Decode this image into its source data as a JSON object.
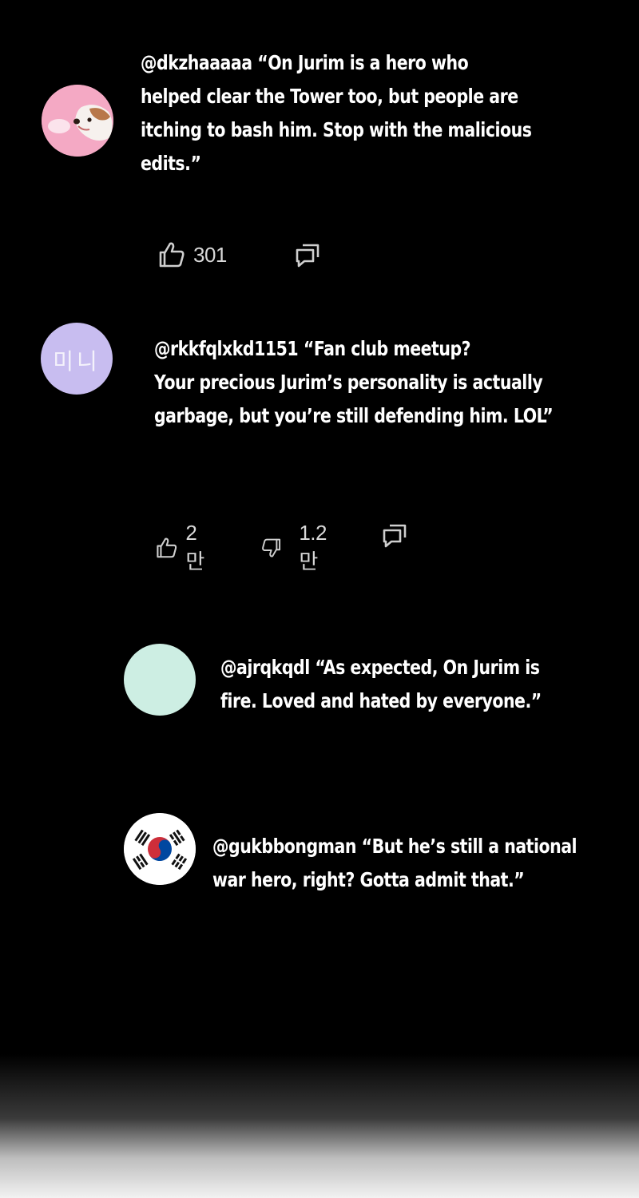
{
  "comments": [
    {
      "avatar": "pink-dog-avatar",
      "lines": [
        "@dkzhaaaaa “On Jurim is a hero who",
        "helped clear the Tower too, but people are",
        " itching to bash him. Stop with the malicious",
        "edits.”"
      ],
      "likes": "301"
    },
    {
      "avatar": "lavender-text-avatar",
      "avatar_text": "미니",
      "lines": [
        "@rkkfqlxkd1151 “Fan club meetup?",
        " Your precious Jurim’s personality is actually",
        " garbage, but you’re still defending him. LOL”"
      ],
      "likes": "2만",
      "dislikes": "1.2만"
    },
    {
      "avatar": "mint-plain-avatar",
      "lines": [
        "@ajrqkqdl “As expected, On Jurim is",
        "fire. Loved and hated by everyone.”"
      ]
    },
    {
      "avatar": "korean-flag-avatar",
      "lines": [
        "@gukbbongman “But he’s still a national",
        "war hero, right? Gotta admit that.”"
      ]
    }
  ],
  "colors": {
    "background": "#000000",
    "text": "#ffffff",
    "count_text": "#d8d8d8",
    "icon": "#cfcfcf",
    "avatar_pink": "#f4a9c4",
    "avatar_lavender": "#c8bdf0",
    "avatar_mint": "#cdeee3",
    "flag_red": "#cd2e3a",
    "flag_blue": "#0047a0"
  }
}
